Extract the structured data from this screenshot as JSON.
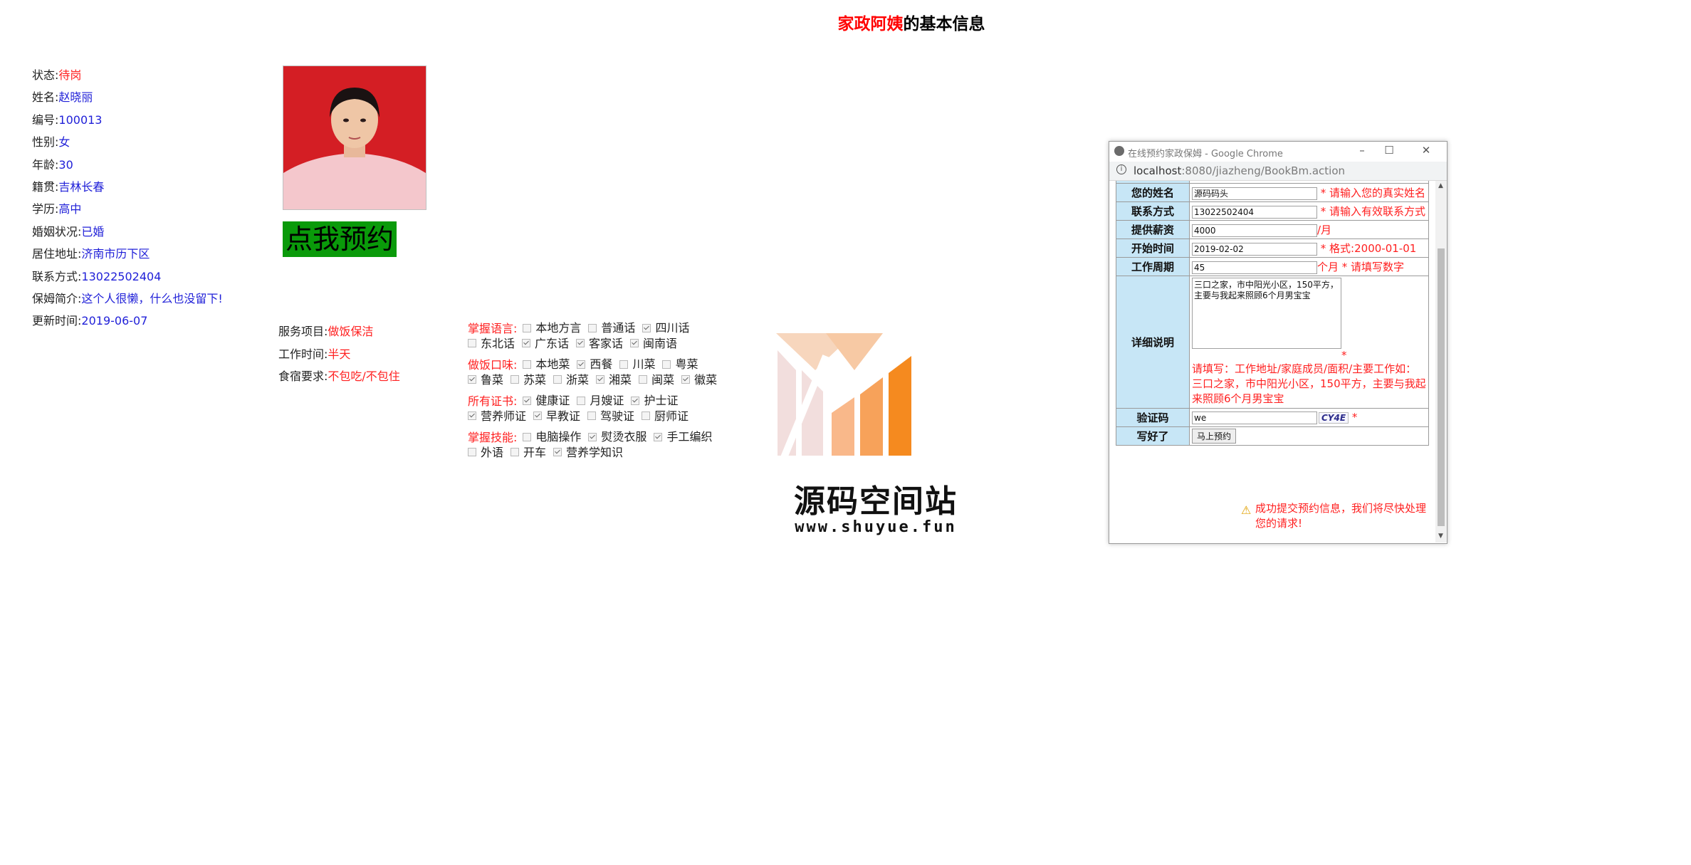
{
  "page_title": {
    "highlight": "家政阿姨",
    "rest": "的基本信息"
  },
  "info": [
    {
      "label": "状态:",
      "value": "待岗",
      "tone": "red"
    },
    {
      "label": "姓名:",
      "value": "赵晓丽",
      "tone": "blue"
    },
    {
      "label": "编号:",
      "value": "100013",
      "tone": "blue"
    },
    {
      "label": "性别:",
      "value": "女",
      "tone": "blue"
    },
    {
      "label": "年龄:",
      "value": "30",
      "tone": "blue"
    },
    {
      "label": "籍贯:",
      "value": "吉林长春",
      "tone": "blue"
    },
    {
      "label": "学历:",
      "value": "高中",
      "tone": "blue"
    },
    {
      "label": "婚姻状况:",
      "value": "已婚",
      "tone": "blue"
    },
    {
      "label": "居住地址:",
      "value": "济南市历下区",
      "tone": "blue"
    },
    {
      "label": "联系方式:",
      "value": "13022502404",
      "tone": "blue"
    },
    {
      "label": "保姆简介:",
      "value": "这个人很懒，什么也没留下!",
      "tone": "blue"
    },
    {
      "label": "更新时间:",
      "value": "2019-06-07",
      "tone": "blue"
    }
  ],
  "book_button": "点我预约",
  "service": [
    {
      "label": "服务项目:",
      "value": "做饭保洁"
    },
    {
      "label": "工作时间:",
      "value": "半天"
    },
    {
      "label": "食宿要求:",
      "value": "不包吃/不包住"
    }
  ],
  "skills": [
    {
      "caption": "掌握语言:",
      "items": [
        {
          "name": "本地方言",
          "checked": false
        },
        {
          "name": "普通话",
          "checked": false
        },
        {
          "name": "四川话",
          "checked": true
        },
        {
          "name": "东北话",
          "checked": false
        },
        {
          "name": "广东话",
          "checked": true
        },
        {
          "name": "客家话",
          "checked": true
        },
        {
          "name": "闽南语",
          "checked": true
        }
      ]
    },
    {
      "caption": "做饭口味:",
      "items": [
        {
          "name": "本地菜",
          "checked": false
        },
        {
          "name": "西餐",
          "checked": true
        },
        {
          "name": "川菜",
          "checked": false
        },
        {
          "name": "粤菜",
          "checked": false
        },
        {
          "name": "鲁菜",
          "checked": true
        },
        {
          "name": "苏菜",
          "checked": false
        },
        {
          "name": "浙菜",
          "checked": false
        },
        {
          "name": "湘菜",
          "checked": true
        },
        {
          "name": "闽菜",
          "checked": false
        },
        {
          "name": "徽菜",
          "checked": true
        }
      ]
    },
    {
      "caption": "所有证书:",
      "items": [
        {
          "name": "健康证",
          "checked": true
        },
        {
          "name": "月嫂证",
          "checked": false
        },
        {
          "name": "护士证",
          "checked": true
        },
        {
          "name": "营养师证",
          "checked": true
        },
        {
          "name": "早教证",
          "checked": true
        },
        {
          "name": "驾驶证",
          "checked": false
        },
        {
          "name": "厨师证",
          "checked": false
        }
      ]
    },
    {
      "caption": "掌握技能:",
      "items": [
        {
          "name": "电脑操作",
          "checked": false
        },
        {
          "name": "熨烫衣服",
          "checked": true
        },
        {
          "name": "手工编织",
          "checked": true
        },
        {
          "name": "外语",
          "checked": false
        },
        {
          "name": "开车",
          "checked": false
        },
        {
          "name": "营养学知识",
          "checked": true
        }
      ]
    }
  ],
  "watermark": {
    "name": "源码空间站",
    "url": "www.shuyue.fun"
  },
  "popup": {
    "window_title": "在线预约家政保姆 - Google Chrome",
    "url_host": "localhost",
    "url_path": ":8080/jiazheng/BookBm.action",
    "rows": {
      "name": {
        "label": "您的姓名",
        "value": "源码码头",
        "hint": "* 请输入您的真实姓名"
      },
      "phone": {
        "label": "联系方式",
        "value": "13022502404",
        "hint": "* 请输入有效联系方式"
      },
      "salary": {
        "label": "提供薪资",
        "value": "4000",
        "unit": "/月"
      },
      "start": {
        "label": "开始时间",
        "value": "2019-02-02",
        "hint": "* 格式:2000-01-01"
      },
      "period": {
        "label": "工作周期",
        "value": "45",
        "hint": "个月 * 请填写数字"
      },
      "detail": {
        "label": "详细说明",
        "value": "三口之家，市中阳光小区，150平方，\n主要与我起来照顾6个月男宝宝",
        "star": "*",
        "hint": "请填写：工作地址/家庭成员/面积/主要工作如：三口之家，市中阳光小区，150平方，主要与我起来照顾6个月男宝宝"
      },
      "captcha": {
        "label": "验证码",
        "value": "we",
        "code": "CY4E",
        "star": "*"
      },
      "submit": {
        "label": "写好了",
        "button": "马上预约"
      }
    },
    "success": "成功提交预约信息，我们将尽快处理您的请求!"
  }
}
